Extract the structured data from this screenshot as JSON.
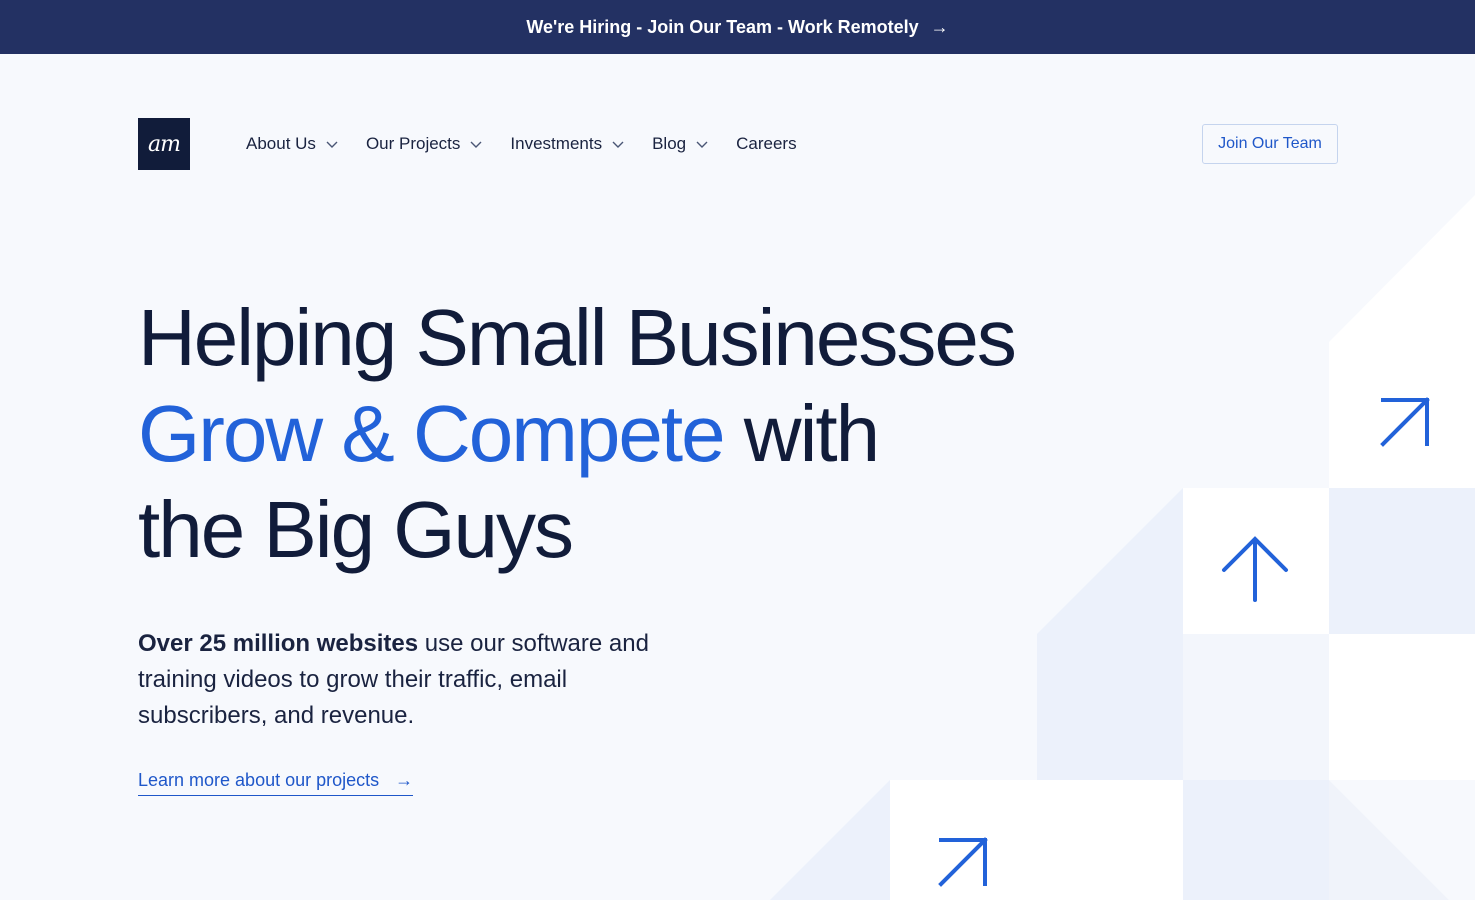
{
  "banner": {
    "text": "We're Hiring - Join Our Team - Work Remotely",
    "arrow": "→"
  },
  "logo": {
    "text": "am"
  },
  "nav": {
    "items": [
      {
        "label": "About Us",
        "has_dropdown": true
      },
      {
        "label": "Our Projects",
        "has_dropdown": true
      },
      {
        "label": "Investments",
        "has_dropdown": true
      },
      {
        "label": "Blog",
        "has_dropdown": true
      },
      {
        "label": "Careers",
        "has_dropdown": false
      }
    ],
    "cta_label": "Join Our Team"
  },
  "hero": {
    "line1": "Helping Small Businesses",
    "accent": "Grow & Compete",
    "line2_rest": " with",
    "line3": "the Big Guys"
  },
  "sub": {
    "bold": "Over 25 million websites",
    "rest": " use our software and training videos to grow their traffic, email subscribers, and revenue."
  },
  "learn_more": {
    "label": "Learn more about our projects",
    "arrow": "→"
  },
  "colors": {
    "banner_bg": "#233163",
    "accent": "#2262d9",
    "text_dark": "#111c3a",
    "page_bg": "#f7f9fd",
    "tile_light": "#ecf1fb"
  },
  "icons": [
    "arrow-up-right-icon",
    "arrow-up-icon",
    "chevron-down-icon",
    "arrow-right-icon"
  ]
}
